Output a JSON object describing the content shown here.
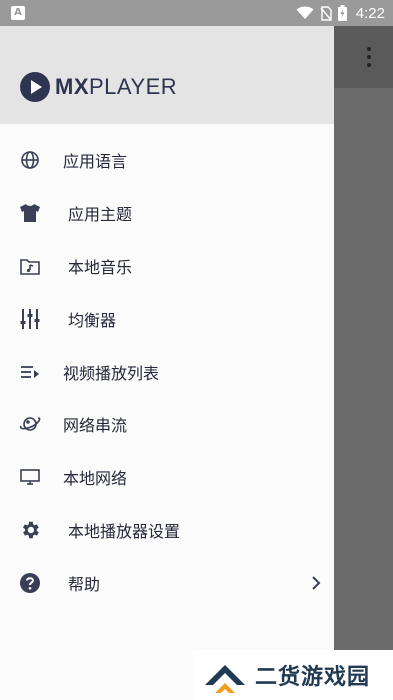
{
  "status_bar": {
    "time": "4:22",
    "icons": [
      "wifi-icon",
      "no-sim-icon",
      "battery-icon"
    ]
  },
  "drawer": {
    "logo": {
      "prefix": "MX",
      "suffix": "PLAYER"
    },
    "items": [
      {
        "label": "应用语言",
        "icon": "globe-icon"
      },
      {
        "label": "应用主题",
        "icon": "tshirt-icon"
      },
      {
        "label": "本地音乐",
        "icon": "music-folder-icon"
      },
      {
        "label": "均衡器",
        "icon": "equalizer-icon"
      },
      {
        "label": "视频播放列表",
        "icon": "playlist-icon"
      },
      {
        "label": "网络串流",
        "icon": "network-stream-icon"
      },
      {
        "label": "本地网络",
        "icon": "local-network-icon"
      },
      {
        "label": "本地播放器设置",
        "icon": "gear-icon"
      },
      {
        "label": "帮助",
        "icon": "help-icon"
      }
    ]
  },
  "watermark": {
    "text": "二货游戏园"
  },
  "colors": {
    "drawer_bg": "#fbfbfb",
    "header_bg": "#e4e4e4",
    "icon": "#3b3f55",
    "brand": "#2f3450"
  }
}
